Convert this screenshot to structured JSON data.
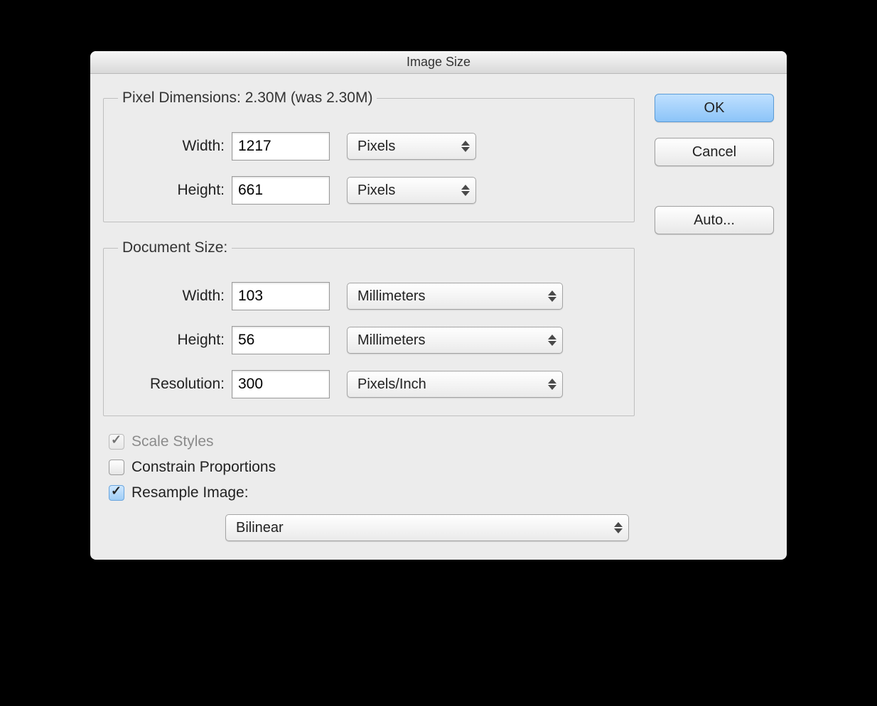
{
  "title": "Image Size",
  "pixel_dimensions": {
    "legend": "Pixel Dimensions:  2.30M (was 2.30M)",
    "width_label": "Width:",
    "width_value": "1217",
    "width_units": "Pixels",
    "height_label": "Height:",
    "height_value": "661",
    "height_units": "Pixels"
  },
  "document_size": {
    "legend": "Document Size:",
    "width_label": "Width:",
    "width_value": "103",
    "width_units": "Millimeters",
    "height_label": "Height:",
    "height_value": "56",
    "height_units": "Millimeters",
    "resolution_label": "Resolution:",
    "resolution_value": "300",
    "resolution_units": "Pixels/Inch"
  },
  "options": {
    "scale_styles": "Scale Styles",
    "constrain_proportions": "Constrain Proportions",
    "resample_image": "Resample Image:",
    "resample_method": "Bilinear"
  },
  "buttons": {
    "ok": "OK",
    "cancel": "Cancel",
    "auto": "Auto..."
  }
}
